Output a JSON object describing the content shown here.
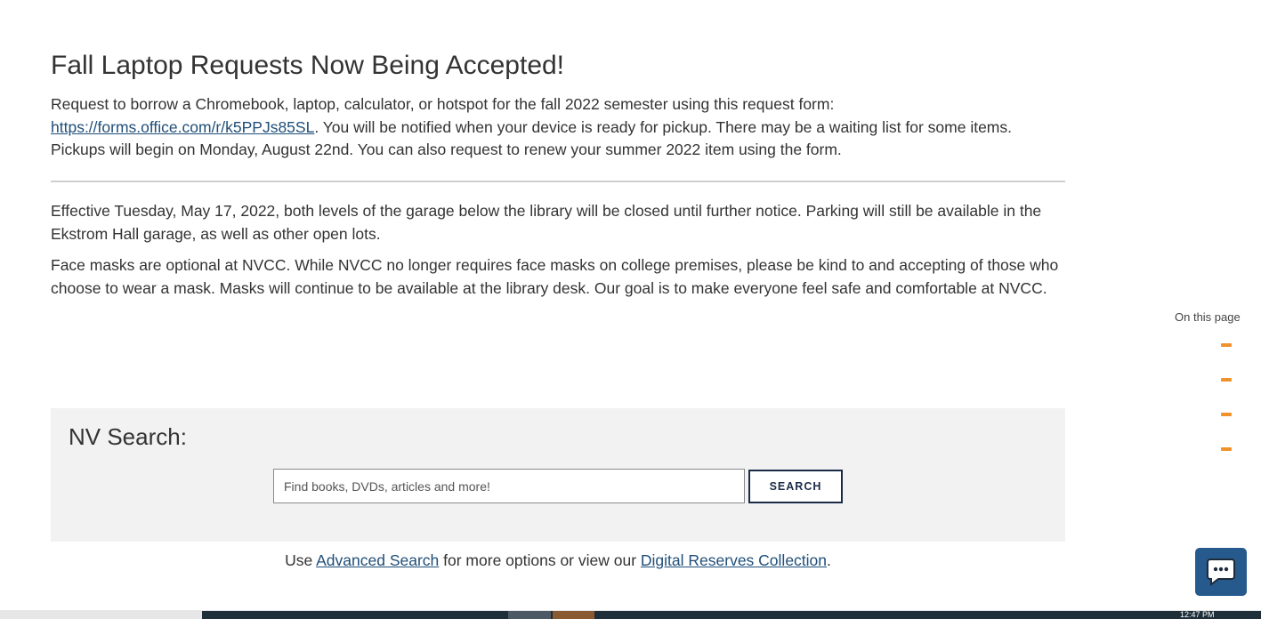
{
  "announcements": {
    "laptop_title": "Fall Laptop Requests Now Being Accepted!",
    "laptop_text_before_link": "Request to borrow a Chromebook, laptop, calculator, or hotspot for the fall 2022 semester using this request form: ",
    "laptop_link": "https://forms.office.com/r/k5PPJs85SL",
    "laptop_text_after_link": ".  You will be notified when your device is ready for pickup. There may be a waiting list for some items. Pickups will begin on Monday, August 22nd. You can also request to renew your summer 2022 item using the form.",
    "garage_text": "Effective Tuesday, May 17, 2022, both levels of the garage below the library will be closed until further notice. Parking will still be available in the Ekstrom Hall garage, as well as other open lots.",
    "masks_text": "Face masks are optional at NVCC. While NVCC no longer requires face masks on college premises, please be kind to and accepting of those who choose to wear a mask. Masks will continue to be available at the library desk. Our goal is to make everyone feel safe and comfortable at NVCC."
  },
  "search": {
    "heading": "NV Search:",
    "placeholder": "Find books, DVDs, articles and more!",
    "value": "",
    "button_label": "SEARCH"
  },
  "advanced": {
    "prefix": "Use ",
    "advanced_link": "Advanced Search",
    "middle": " for more options or view our ",
    "digital_link": "Digital Reserves Collection",
    "suffix": "."
  },
  "toc": {
    "label": "On this page",
    "marker_count": 4,
    "marker_color": "#f0922c"
  },
  "chat": {
    "icon": "chat-bubble-icon",
    "color": "#265a8c"
  },
  "taskbar": {
    "clock": "12:47 PM"
  }
}
